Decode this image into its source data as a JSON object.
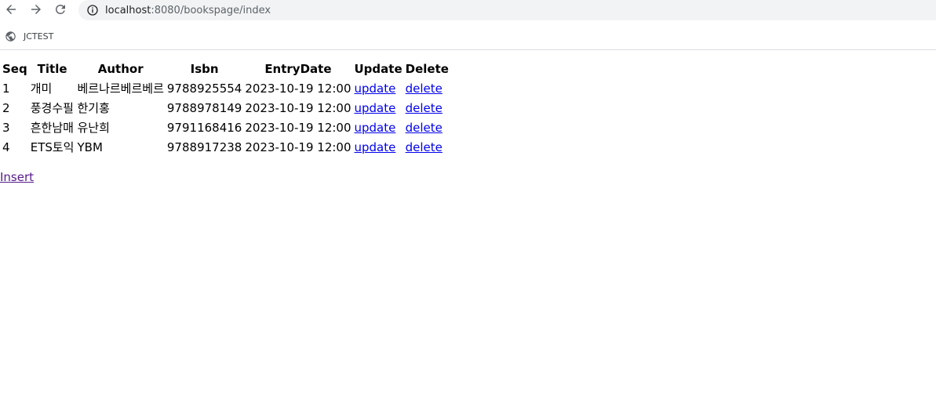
{
  "browser": {
    "url_host": "localhost",
    "url_rest": ":8080/bookspage/index",
    "bookmark_label": "JCTEST"
  },
  "table": {
    "headers": [
      "Seq",
      "Title",
      "Author",
      "Isbn",
      "EntryDate",
      "Update",
      "Delete"
    ],
    "rows": [
      {
        "seq": "1",
        "title": "개미",
        "author": "베르나르베르베르",
        "isbn": "9788925554",
        "entry_date": "2023-10-19 12:00",
        "update": "update",
        "delete": "delete"
      },
      {
        "seq": "2",
        "title": "풍경수필",
        "author": "한기홍",
        "isbn": "9788978149",
        "entry_date": "2023-10-19 12:00",
        "update": "update",
        "delete": "delete"
      },
      {
        "seq": "3",
        "title": "흔한남매",
        "author": "유난희",
        "isbn": "9791168416",
        "entry_date": "2023-10-19 12:00",
        "update": "update",
        "delete": "delete"
      },
      {
        "seq": "4",
        "title": "ETS토익",
        "author": "YBM",
        "isbn": "9788917238",
        "entry_date": "2023-10-19 12:00",
        "update": "update",
        "delete": "delete"
      }
    ]
  },
  "insert_label": "Insert",
  "colors": {
    "link": "#0000ee",
    "visited_link": "#551a8b",
    "omnibox_bg": "#f1f3f4"
  },
  "icons": [
    "back-arrow-icon",
    "forward-arrow-icon",
    "reload-icon",
    "info-icon",
    "globe-icon"
  ]
}
